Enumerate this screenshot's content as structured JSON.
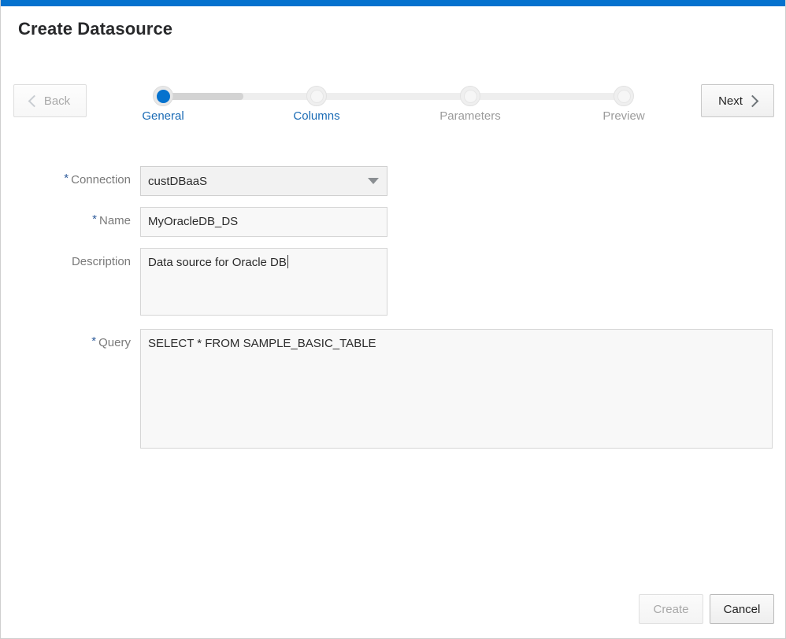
{
  "window": {
    "accent_color": "#0572ce",
    "title": "Create Datasource"
  },
  "wizard": {
    "back_label": "Back",
    "next_label": "Next",
    "back_disabled": true,
    "steps": [
      {
        "label": "General",
        "state": "active"
      },
      {
        "label": "Columns",
        "state": "link"
      },
      {
        "label": "Parameters",
        "state": "disabled"
      },
      {
        "label": "Preview",
        "state": "disabled"
      }
    ]
  },
  "form": {
    "connection": {
      "label": "Connection",
      "required": true,
      "value": "custDBaaS"
    },
    "name": {
      "label": "Name",
      "required": true,
      "value": "MyOracleDB_DS"
    },
    "description": {
      "label": "Description",
      "required": false,
      "value": "Data source for Oracle DB"
    },
    "query": {
      "label": "Query",
      "required": true,
      "value": "SELECT * FROM SAMPLE_BASIC_TABLE"
    }
  },
  "footer": {
    "create_label": "Create",
    "create_disabled": true,
    "cancel_label": "Cancel"
  }
}
